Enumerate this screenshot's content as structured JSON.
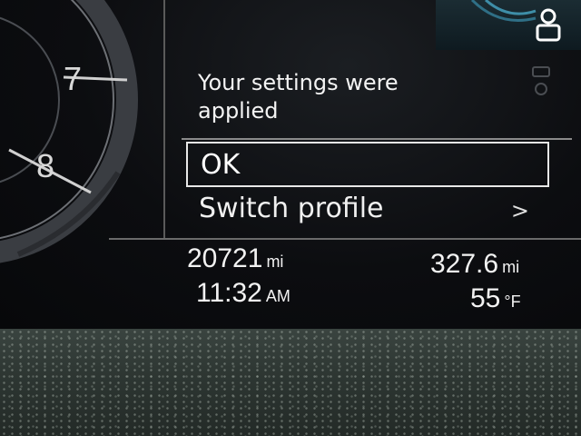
{
  "gauge": {
    "ticks": [
      "7",
      "8"
    ]
  },
  "dialog": {
    "message": "Your settings were applied",
    "options": [
      {
        "label": "OK",
        "selected": true
      },
      {
        "label": "Switch profile",
        "chevron": ">"
      }
    ]
  },
  "info": {
    "odometer": {
      "value": "20721",
      "unit": "mi"
    },
    "clock": {
      "time": "11:32",
      "ampm": "AM"
    },
    "range": {
      "value": "327.6",
      "unit": "mi"
    },
    "temperature": {
      "value": "55",
      "unit": "°F"
    }
  },
  "icons": [
    "profile-icon",
    "profile-icon-secondary"
  ]
}
